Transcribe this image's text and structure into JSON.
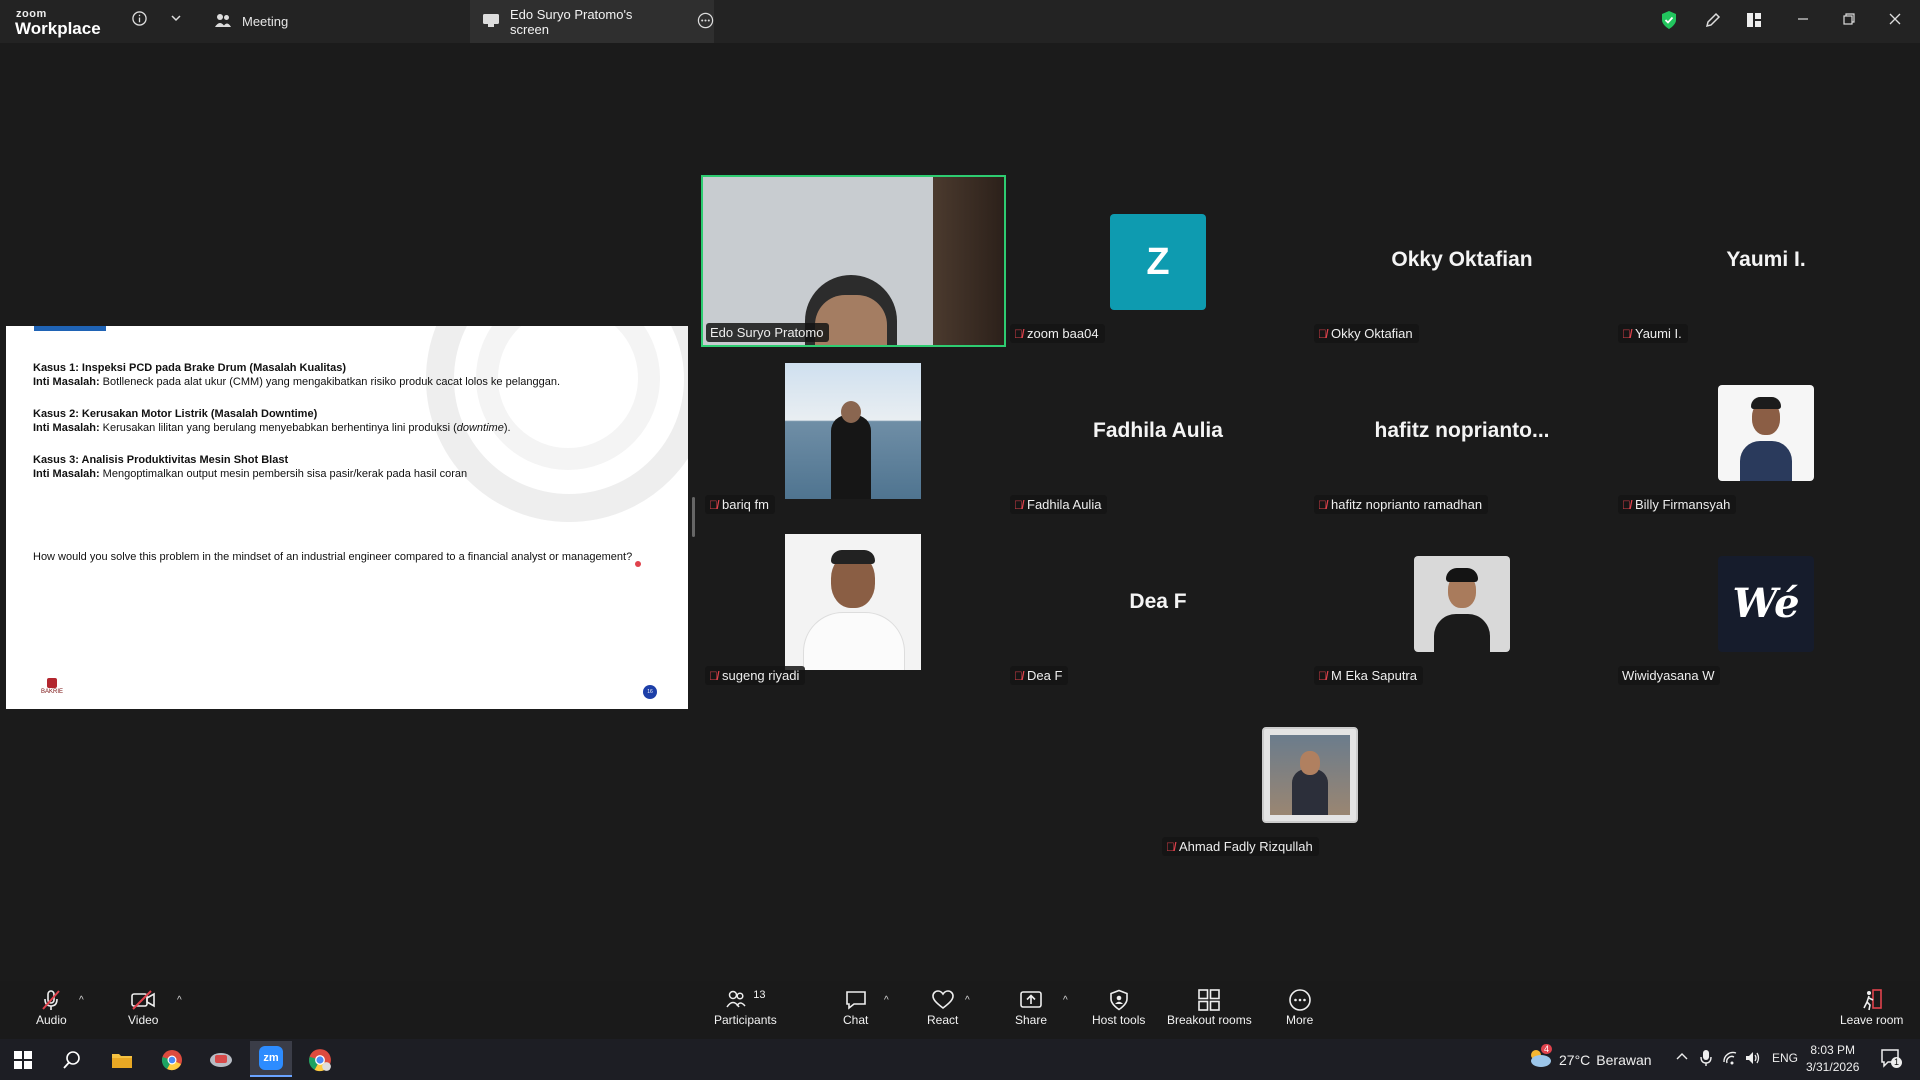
{
  "titlebar": {
    "logo_top": "zoom",
    "logo_bottom": "Workplace",
    "meeting_tab": "Meeting",
    "screen_tab": "Edo Suryo Pratomo's screen"
  },
  "slide": {
    "case1_title": "Kasus 1: Inspeksi PCD pada Brake Drum (Masalah Kualitas)",
    "case1_label": "Inti Masalah:",
    "case1_text": " Botlleneck pada alat ukur (CMM) yang mengakibatkan risiko produk cacat lolos ke pelanggan.",
    "case2_title": "Kasus 2: Kerusakan Motor Listrik (Masalah Downtime)",
    "case2_label": "Inti Masalah:",
    "case2_text": " Kerusakan lilitan yang berulang menyebabkan berhentinya lini produksi (",
    "case2_italic": "downtime",
    "case2_end": ").",
    "case3_title": "Kasus 3: Analisis Produktivitas Mesin Shot Blast",
    "case3_label": "Inti Masalah:",
    "case3_text": " Mengoptimalkan output mesin pembersih sisa pasir/kerak pada hasil coran",
    "question": "How would you solve this problem in the mindset of an industrial engineer compared to a financial analyst or management?",
    "logo_text": "BAKRIE",
    "page_number": "16"
  },
  "participants": [
    {
      "name": "Edo Suryo Pratomo",
      "type": "video",
      "muted": false
    },
    {
      "name": "zoom baa04",
      "type": "letter",
      "letter": "Z",
      "muted": true
    },
    {
      "name": "Okky Oktafian",
      "display": "Okky Oktafian",
      "type": "text",
      "muted": true
    },
    {
      "name": "Yaumi I.",
      "display": "Yaumi I.",
      "type": "text",
      "muted": true
    },
    {
      "name": "bariq fm",
      "type": "photo",
      "muted": true
    },
    {
      "name": "Fadhila Aulia",
      "display": "Fadhila Aulia",
      "type": "text",
      "muted": true
    },
    {
      "name": "hafitz noprianto ramadhan",
      "display": "hafitz  noprianto...",
      "type": "text",
      "muted": true
    },
    {
      "name": "Billy Firmansyah",
      "type": "photo",
      "muted": true
    },
    {
      "name": "sugeng riyadi",
      "type": "photo",
      "muted": true
    },
    {
      "name": "Dea F",
      "display": "Dea F",
      "type": "text",
      "muted": true
    },
    {
      "name": "M Eka Saputra",
      "type": "photo",
      "muted": true
    },
    {
      "name": "Wiwidyasana W",
      "type": "logo",
      "logo_text": "Wé",
      "muted": false
    },
    {
      "name": "Ahmad Fadly Rizqullah",
      "type": "photo",
      "muted": true
    }
  ],
  "toolbar": {
    "audio": "Audio",
    "video": "Video",
    "participants": "Participants",
    "participants_count": "13",
    "chat": "Chat",
    "react": "React",
    "share": "Share",
    "host_tools": "Host tools",
    "breakout_rooms": "Breakout rooms",
    "more": "More",
    "leave_room": "Leave room"
  },
  "taskbar": {
    "weather_temp": "27°C",
    "weather_desc": "Berawan",
    "weather_badge": "4",
    "language": "ENG",
    "time": "8:03 PM",
    "date": "3/31/2026",
    "notification_count": "1"
  },
  "colors": {
    "active_speaker": "#2ecc71",
    "muted_red": "#e0424c",
    "letter_avatar": "#0e9bb0"
  }
}
